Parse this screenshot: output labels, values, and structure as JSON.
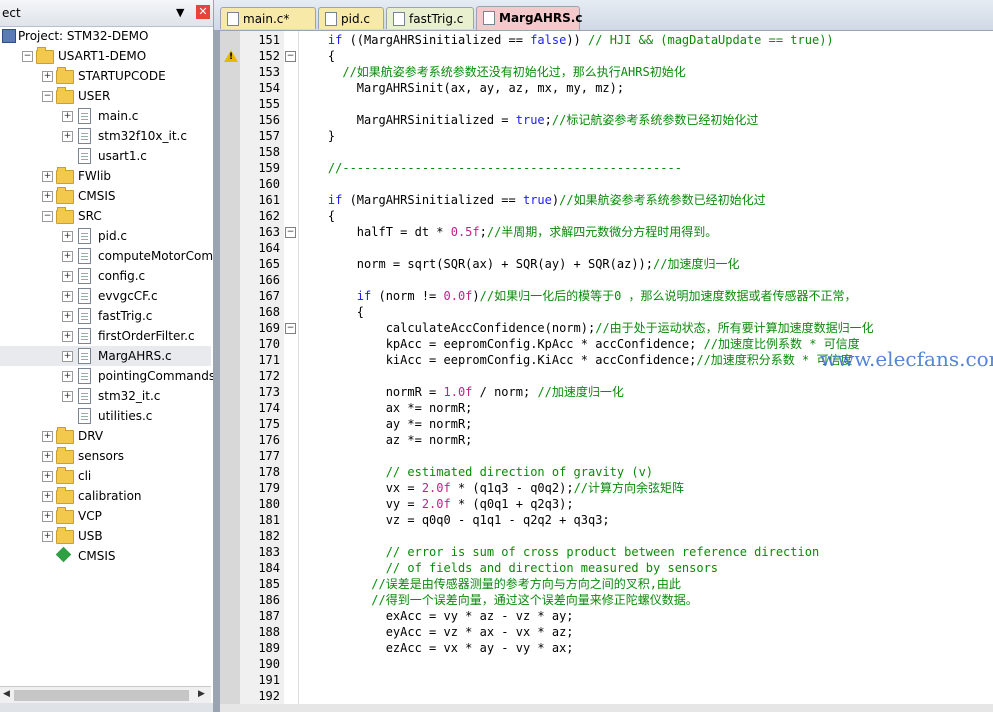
{
  "project_panel": {
    "title": "ect",
    "pin": "▼",
    "close": "✕",
    "tree": [
      {
        "label": "Project: STM32-DEMO",
        "type": "project",
        "level": 0,
        "exp": ""
      },
      {
        "label": "USART1-DEMO",
        "type": "folder",
        "level": 1,
        "exp": "−"
      },
      {
        "label": "STARTUPCODE",
        "type": "folder",
        "level": 2,
        "exp": "+"
      },
      {
        "label": "USER",
        "type": "folder",
        "level": 2,
        "exp": "−"
      },
      {
        "label": "main.c",
        "type": "file",
        "level": 3,
        "exp": "+"
      },
      {
        "label": "stm32f10x_it.c",
        "type": "file",
        "level": 3,
        "exp": "+"
      },
      {
        "label": "usart1.c",
        "type": "file",
        "level": 3,
        "exp": ""
      },
      {
        "label": "FWlib",
        "type": "folder",
        "level": 2,
        "exp": "+"
      },
      {
        "label": "CMSIS",
        "type": "folder",
        "level": 2,
        "exp": "+"
      },
      {
        "label": "SRC",
        "type": "folder",
        "level": 2,
        "exp": "−"
      },
      {
        "label": "pid.c",
        "type": "file",
        "level": 3,
        "exp": "+"
      },
      {
        "label": "computeMotorComman",
        "type": "file",
        "level": 3,
        "exp": "+"
      },
      {
        "label": "config.c",
        "type": "file",
        "level": 3,
        "exp": "+"
      },
      {
        "label": "evvgcCF.c",
        "type": "file",
        "level": 3,
        "exp": "+"
      },
      {
        "label": "fastTrig.c",
        "type": "file",
        "level": 3,
        "exp": "+"
      },
      {
        "label": "firstOrderFilter.c",
        "type": "file",
        "level": 3,
        "exp": "+"
      },
      {
        "label": "MargAHRS.c",
        "type": "file",
        "level": 3,
        "exp": "+",
        "selected": true
      },
      {
        "label": "pointingCommands.c",
        "type": "file",
        "level": 3,
        "exp": "+"
      },
      {
        "label": "stm32_it.c",
        "type": "file",
        "level": 3,
        "exp": "+"
      },
      {
        "label": "utilities.c",
        "type": "file",
        "level": 3,
        "exp": ""
      },
      {
        "label": "DRV",
        "type": "folder",
        "level": 2,
        "exp": "+"
      },
      {
        "label": "sensors",
        "type": "folder",
        "level": 2,
        "exp": "+"
      },
      {
        "label": "cli",
        "type": "folder",
        "level": 2,
        "exp": "+"
      },
      {
        "label": "calibration",
        "type": "folder",
        "level": 2,
        "exp": "+"
      },
      {
        "label": "VCP",
        "type": "folder",
        "level": 2,
        "exp": "+"
      },
      {
        "label": "USB",
        "type": "folder",
        "level": 2,
        "exp": "+"
      },
      {
        "label": "CMSIS",
        "type": "cmsis",
        "level": 2,
        "exp": ""
      }
    ]
  },
  "tabs": [
    {
      "label": "main.c*",
      "color": "#f7e9a8",
      "active": false
    },
    {
      "label": "pid.c",
      "color": "#f7e9a8",
      "active": false
    },
    {
      "label": "fastTrig.c",
      "color": "#e9f0d0",
      "active": false
    },
    {
      "label": "MargAHRS.c",
      "color": "#f4c9cc",
      "active": true
    }
  ],
  "editor": {
    "watermark": "www.elecfans.com",
    "fold_lines": [
      152,
      163,
      169
    ],
    "warning_line": 151,
    "lines": [
      {
        "n": 151,
        "segs": [
          [
            "    ",
            ""
          ],
          [
            "if",
            "kw"
          ],
          [
            " ((MargAHRSinitialized == ",
            ""
          ],
          [
            "false",
            "kw"
          ],
          [
            ")) ",
            ""
          ],
          [
            "// HJI && (magDataUpdate == true))",
            "cm"
          ]
        ]
      },
      {
        "n": 152,
        "segs": [
          [
            "    {",
            ""
          ]
        ]
      },
      {
        "n": 153,
        "segs": [
          [
            "      ",
            ""
          ],
          [
            "//如果航姿参考系统参数还没有初始化过，那么执行AHRS初始化",
            "cm"
          ]
        ]
      },
      {
        "n": 154,
        "segs": [
          [
            "        MargAHRSinit(ax, ay, az, mx, my, mz);",
            ""
          ]
        ]
      },
      {
        "n": 155,
        "segs": [
          [
            "",
            ""
          ]
        ]
      },
      {
        "n": 156,
        "segs": [
          [
            "        MargAHRSinitialized = ",
            ""
          ],
          [
            "true",
            "kw"
          ],
          [
            ";",
            ""
          ],
          [
            "//标记航姿参考系统参数已经初始化过",
            "cm"
          ]
        ]
      },
      {
        "n": 157,
        "segs": [
          [
            "    }",
            ""
          ]
        ]
      },
      {
        "n": 158,
        "segs": [
          [
            "",
            ""
          ]
        ]
      },
      {
        "n": 159,
        "segs": [
          [
            "    ",
            ""
          ],
          [
            "//-----------------------------------------------",
            "cm"
          ]
        ]
      },
      {
        "n": 160,
        "segs": [
          [
            "",
            ""
          ]
        ]
      },
      {
        "n": 161,
        "segs": [
          [
            "    ",
            ""
          ],
          [
            "if",
            "kw"
          ],
          [
            " (MargAHRSinitialized == ",
            ""
          ],
          [
            "true",
            "kw"
          ],
          [
            ")",
            ""
          ],
          [
            "//如果航姿参考系统参数已经初始化过",
            "cm"
          ]
        ]
      },
      {
        "n": 162,
        "segs": [
          [
            "    {",
            ""
          ]
        ]
      },
      {
        "n": 163,
        "segs": [
          [
            "        halfT = dt * ",
            ""
          ],
          [
            "0.5f",
            "nm"
          ],
          [
            ";",
            ""
          ],
          [
            "//半周期，求解四元数微分方程时用得到。",
            "cm"
          ]
        ]
      },
      {
        "n": 164,
        "segs": [
          [
            "",
            ""
          ]
        ]
      },
      {
        "n": 165,
        "segs": [
          [
            "        norm = sqrt(SQR(ax) + SQR(ay) + SQR(az));",
            ""
          ],
          [
            "//加速度归一化",
            "cm"
          ]
        ]
      },
      {
        "n": 166,
        "segs": [
          [
            "",
            ""
          ]
        ]
      },
      {
        "n": 167,
        "segs": [
          [
            "        ",
            ""
          ],
          [
            "if",
            "kw"
          ],
          [
            " (norm != ",
            ""
          ],
          [
            "0.0f",
            "nm"
          ],
          [
            ")",
            ""
          ],
          [
            "//如果归一化后的模等于0 ，那么说明加速度数据或者传感器不正常，",
            "cm"
          ]
        ]
      },
      {
        "n": 168,
        "segs": [
          [
            "        {",
            ""
          ]
        ]
      },
      {
        "n": 169,
        "segs": [
          [
            "            calculateAccConfidence(norm);",
            ""
          ],
          [
            "//由于处于运动状态，所有要计算加速度数据归一化",
            "cm"
          ]
        ]
      },
      {
        "n": 170,
        "segs": [
          [
            "            kpAcc = eepromConfig.KpAcc * accConfidence; ",
            ""
          ],
          [
            "//加速度比例系数 * 可信度",
            "cm"
          ]
        ]
      },
      {
        "n": 171,
        "segs": [
          [
            "            kiAcc = eepromConfig.KiAcc * accConfidence;",
            ""
          ],
          [
            "//加速度积分系数 * 可信度",
            "cm"
          ]
        ]
      },
      {
        "n": 172,
        "segs": [
          [
            "",
            ""
          ]
        ]
      },
      {
        "n": 173,
        "segs": [
          [
            "            normR = ",
            ""
          ],
          [
            "1.0f",
            "nm"
          ],
          [
            " / norm; ",
            ""
          ],
          [
            "//加速度归一化",
            "cm"
          ]
        ]
      },
      {
        "n": 174,
        "segs": [
          [
            "            ax *= normR;",
            ""
          ]
        ]
      },
      {
        "n": 175,
        "segs": [
          [
            "            ay *= normR;",
            ""
          ]
        ]
      },
      {
        "n": 176,
        "segs": [
          [
            "            az *= normR;",
            ""
          ]
        ]
      },
      {
        "n": 177,
        "segs": [
          [
            "",
            ""
          ]
        ]
      },
      {
        "n": 178,
        "segs": [
          [
            "            ",
            ""
          ],
          [
            "// estimated direction of gravity (v)",
            "cm"
          ]
        ]
      },
      {
        "n": 179,
        "segs": [
          [
            "            vx = ",
            ""
          ],
          [
            "2.0f",
            "nm"
          ],
          [
            " * (q1q3 - q0q2);",
            ""
          ],
          [
            "//计算方向余弦矩阵",
            "cm"
          ]
        ]
      },
      {
        "n": 180,
        "segs": [
          [
            "            vy = ",
            ""
          ],
          [
            "2.0f",
            "nm"
          ],
          [
            " * (q0q1 + q2q3);",
            ""
          ]
        ]
      },
      {
        "n": 181,
        "segs": [
          [
            "            vz = q0q0 - q1q1 - q2q2 + q3q3;",
            ""
          ]
        ]
      },
      {
        "n": 182,
        "segs": [
          [
            "",
            ""
          ]
        ]
      },
      {
        "n": 183,
        "segs": [
          [
            "            ",
            ""
          ],
          [
            "// error is sum of cross product between reference direction",
            "cm"
          ]
        ]
      },
      {
        "n": 184,
        "segs": [
          [
            "            ",
            ""
          ],
          [
            "// of fields and direction measured by sensors",
            "cm"
          ]
        ]
      },
      {
        "n": 185,
        "segs": [
          [
            "          ",
            ""
          ],
          [
            "//误差是由传感器测量的参考方向与方向之间的叉积,由此",
            "cm"
          ]
        ]
      },
      {
        "n": 186,
        "segs": [
          [
            "          ",
            ""
          ],
          [
            "//得到一个误差向量，通过这个误差向量来修正陀螺仪数据。",
            "cm"
          ]
        ]
      },
      {
        "n": 187,
        "segs": [
          [
            "            exAcc = vy * az - vz * ay;",
            ""
          ]
        ]
      },
      {
        "n": 188,
        "segs": [
          [
            "            eyAcc = vz * ax - vx * az;",
            ""
          ]
        ]
      },
      {
        "n": 189,
        "segs": [
          [
            "            ezAcc = vx * ay - vy * ax;",
            ""
          ]
        ]
      },
      {
        "n": 190,
        "segs": [
          [
            "",
            ""
          ]
        ]
      },
      {
        "n": 191,
        "segs": [
          [
            "",
            ""
          ]
        ]
      },
      {
        "n": 192,
        "segs": [
          [
            "",
            ""
          ]
        ]
      }
    ]
  }
}
